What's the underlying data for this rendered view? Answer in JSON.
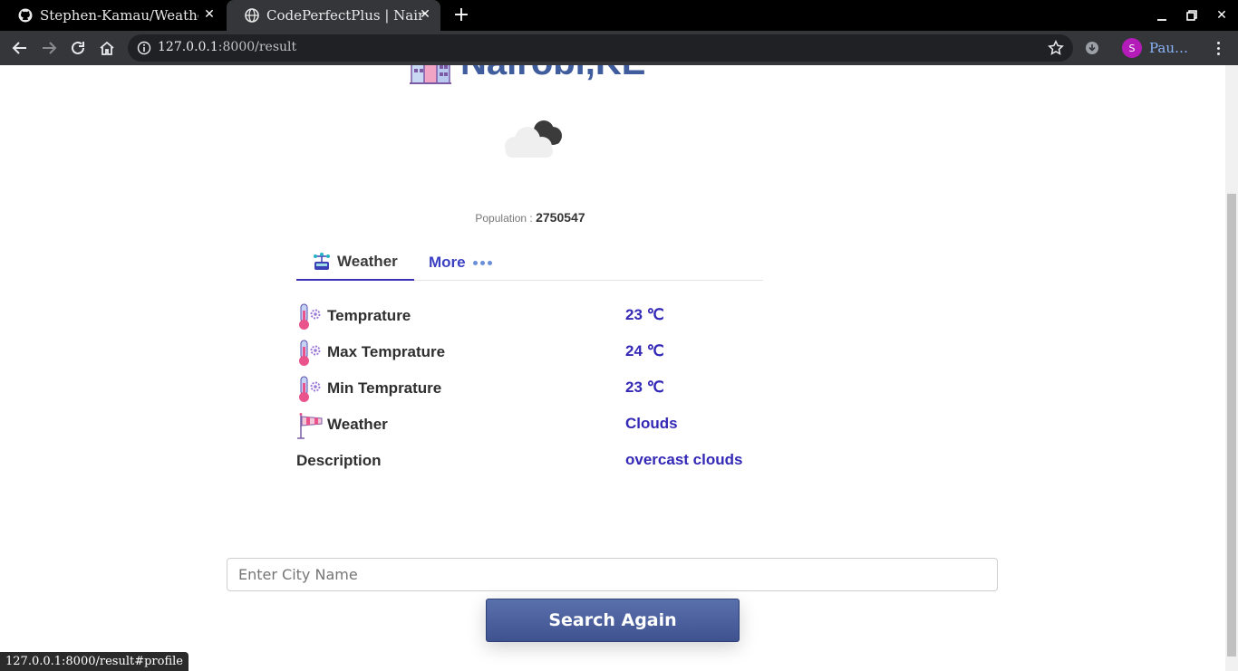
{
  "browser": {
    "tabs": [
      {
        "title": "Stephen-Kamau/Weather",
        "favicon": "github-icon",
        "active": false
      },
      {
        "title": "CodePerfectPlus | Nairobi",
        "favicon": "globe-icon",
        "active": true
      }
    ],
    "url_host": "127.0.0.1",
    "url_path": ":8000/result",
    "profile_initial": "S",
    "profile_name": "Pau…"
  },
  "page": {
    "city": "Nairobi,KE",
    "population_label": "Population :",
    "population_value": "2750547",
    "tabs": [
      {
        "label": "Weather",
        "icon": "weather-station-icon",
        "active": true
      },
      {
        "label": "More",
        "icon": "more-dots-icon",
        "active": false
      }
    ],
    "rows": [
      {
        "label": "Temprature",
        "value": "23 ℃",
        "icon": "thermometer-icon"
      },
      {
        "label": "Max Temprature",
        "value": "24 ℃",
        "icon": "thermometer-icon"
      },
      {
        "label": "Min Temprature",
        "value": "23 ℃",
        "icon": "thermometer-icon"
      },
      {
        "label": "Weather",
        "value": "Clouds",
        "icon": "windsock-icon"
      },
      {
        "label": "Description",
        "value": "overcast clouds",
        "icon": ""
      }
    ],
    "search_placeholder": "Enter City Name",
    "search_button": "Search Again"
  },
  "status_bar_url": "127.0.0.1:8000/result#profile",
  "colors": {
    "city_title": "#3f5c9c",
    "value_text": "#3428b6",
    "active_tab_underline": "#3b2fb8",
    "button_bg": "#4a5f9c"
  }
}
